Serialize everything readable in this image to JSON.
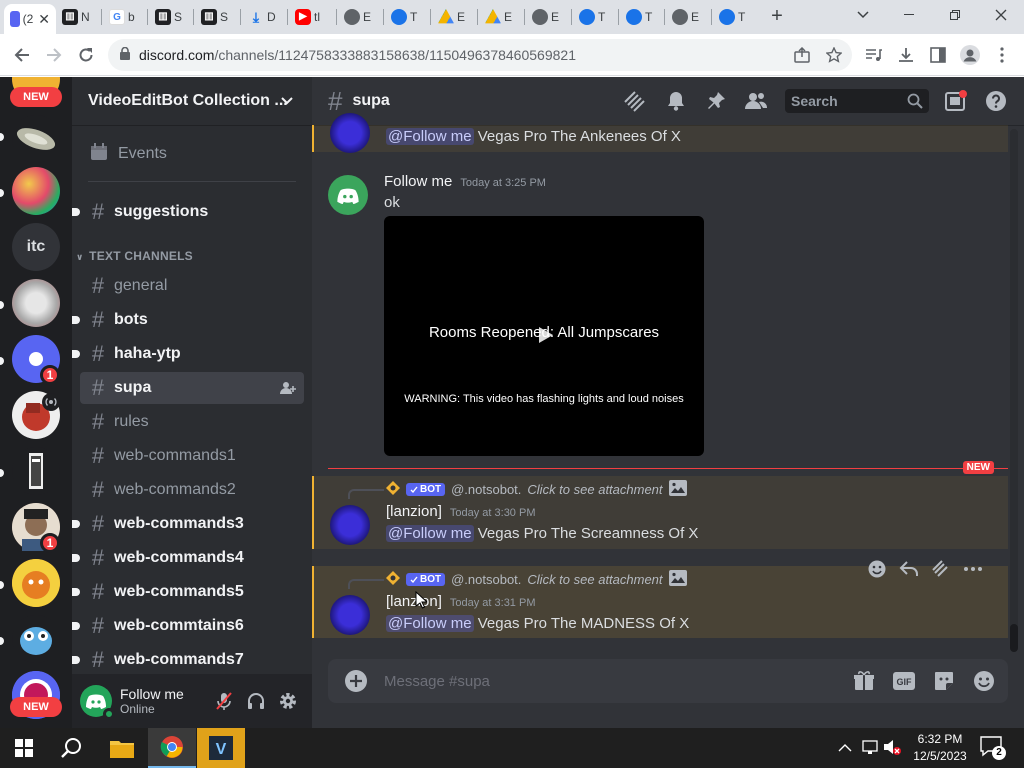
{
  "browser": {
    "tabs": [
      {
        "label": "(2",
        "favicon": "discord-icon",
        "color": "#5865f2"
      },
      {
        "label": "N",
        "favicon": "n-icon",
        "color": "#202124"
      },
      {
        "label": "b",
        "favicon": "google-icon",
        "color": "#4285f4"
      },
      {
        "label": "S",
        "favicon": "s-icon",
        "color": "#202124"
      },
      {
        "label": "S",
        "favicon": "s-icon",
        "color": "#202124"
      },
      {
        "label": "D",
        "favicon": "download-icon",
        "color": "#1a73e8"
      },
      {
        "label": "tl",
        "favicon": "youtube-icon",
        "color": "#ff0000"
      },
      {
        "label": "E",
        "favicon": "globe-icon",
        "color": "#5f6368"
      },
      {
        "label": "T",
        "favicon": "edge-icon",
        "color": "#1a73e8"
      },
      {
        "label": "E",
        "favicon": "drive-icon",
        "color": "#0f9d58"
      },
      {
        "label": "E",
        "favicon": "drive-icon",
        "color": "#0f9d58"
      },
      {
        "label": "E",
        "favicon": "globe-icon",
        "color": "#5f6368"
      },
      {
        "label": "T",
        "favicon": "edge-icon",
        "color": "#1a73e8"
      },
      {
        "label": "T",
        "favicon": "edge-icon",
        "color": "#1a73e8"
      },
      {
        "label": "E",
        "favicon": "globe-icon",
        "color": "#5f6368"
      },
      {
        "label": "T",
        "favicon": "edge-icon",
        "color": "#1a73e8"
      }
    ],
    "url_host": "discord.com",
    "url_path": "/channels/1124758333883158638/1150496378460569821"
  },
  "servers": {
    "items": [
      {
        "name": "server-1",
        "label": "",
        "color": "#f0b232"
      },
      {
        "name": "server-2",
        "label": "",
        "color": "#a2a39a"
      },
      {
        "name": "server-3",
        "label": "",
        "color": "#e34a6a"
      },
      {
        "name": "server-itc",
        "label": "itc",
        "color": "#313338"
      },
      {
        "name": "server-5",
        "label": "",
        "color": "#b5646a"
      },
      {
        "name": "server-6",
        "label": "",
        "color": "#5865f2"
      },
      {
        "name": "server-7",
        "label": "",
        "color": "#c0392b"
      },
      {
        "name": "server-8",
        "label": "",
        "color": "#444"
      },
      {
        "name": "server-9",
        "label": "",
        "color": "#7a5c45"
      },
      {
        "name": "server-10",
        "label": "",
        "color": "#e67e22"
      },
      {
        "name": "server-11",
        "label": "",
        "color": "#5dade2"
      },
      {
        "name": "server-12",
        "label": "",
        "color": "#c2185b"
      }
    ],
    "new_label": "NEW",
    "mention_badge": "1"
  },
  "guild": {
    "name": "VideoEditBot Collection ...",
    "events_label": "Events",
    "category_text": "TEXT CHANNELS",
    "channels": {
      "suggestions": "suggestions",
      "general": "general",
      "bots": "bots",
      "haha": "haha-ytp",
      "supa": "supa",
      "rules": "rules",
      "wc1": "web-commands1",
      "wc2": "web-commands2",
      "wc3": "web-commands3",
      "wc4": "web-commands4",
      "wc5": "web-commands5",
      "wc6": "web-commtains6",
      "wc7": "web-commands7"
    }
  },
  "user": {
    "name": "Follow me",
    "status": "Online"
  },
  "chat": {
    "channel": "supa",
    "search_placeholder": "Search",
    "msg0": {
      "mention": "@Follow me",
      "text": "Vegas Pro The Ankenees Of X"
    },
    "msg1": {
      "author": "Follow me",
      "time": "Today at 3:25 PM",
      "text": "ok",
      "video_title": "Rooms Reopened: All Jumpscares",
      "video_warning": "WARNING: This video has flashing lights and loud noises"
    },
    "new_divider": "NEW",
    "msg2": {
      "bot_tag": "BOT",
      "reply_author": "@.notsobot.",
      "reply_text": "Click to see attachment",
      "author": "[lanzion]",
      "time": "Today at 3:30 PM",
      "mention": "@Follow me",
      "text": "Vegas Pro The Screamness Of X"
    },
    "msg3": {
      "bot_tag": "BOT",
      "reply_author": "@.notsobot.",
      "reply_text": "Click to see attachment",
      "author": "[lanzion]",
      "time": "Today at 3:31 PM",
      "mention": "@Follow me",
      "text": "Vegas Pro The MADNESS Of X"
    },
    "composer_placeholder": "Message #supa"
  },
  "taskbar": {
    "time": "6:32 PM",
    "date": "12/5/2023",
    "notif_count": "2"
  }
}
